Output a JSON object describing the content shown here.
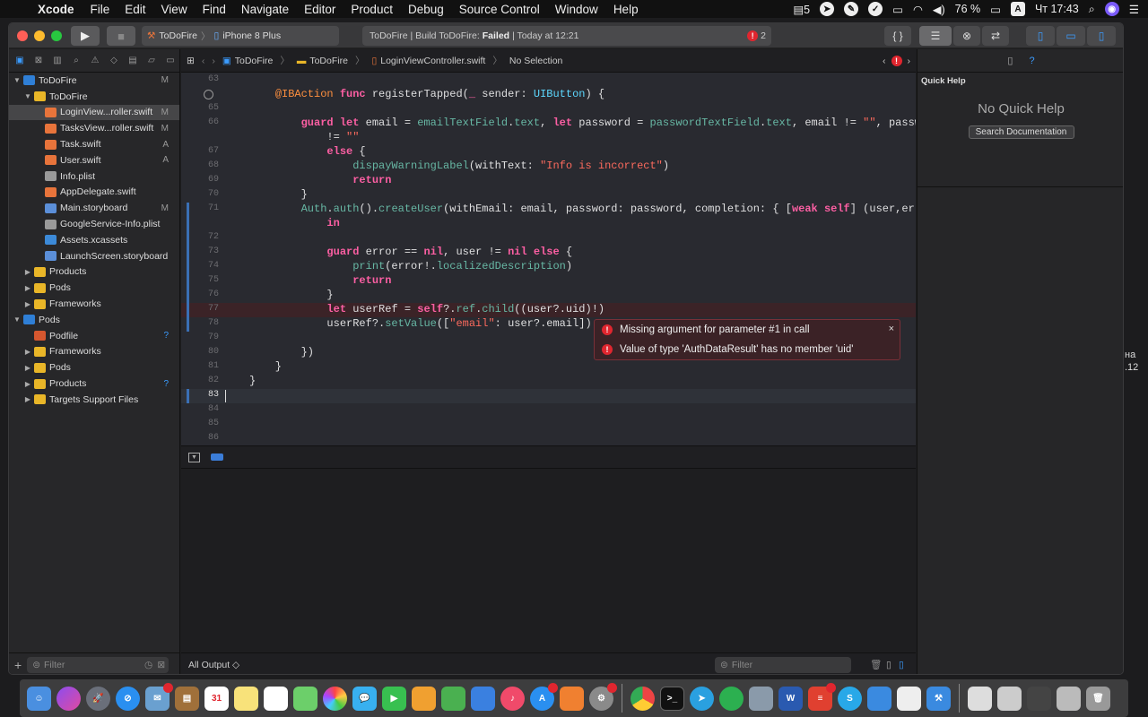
{
  "menubar": {
    "app": "Xcode",
    "menus": [
      "File",
      "Edit",
      "View",
      "Find",
      "Navigate",
      "Editor",
      "Product",
      "Debug",
      "Source Control",
      "Window",
      "Help"
    ],
    "right": {
      "badge_count": "5",
      "battery": "76 %",
      "input_lang": "A",
      "clock": "Чт 17:43"
    }
  },
  "toolbar": {
    "scheme_project": "ToDoFire",
    "scheme_device": "iPhone 8 Plus",
    "status_prefix": "ToDoFire | Build ToDoFire:",
    "status_result": "Failed",
    "status_time": "| Today at 12:21",
    "error_count": "2",
    "braces": "{ }"
  },
  "navigator": {
    "items": [
      {
        "label": "ToDoFire",
        "status": "M",
        "indent": 0,
        "icon": "proj",
        "disc": "▼"
      },
      {
        "label": "ToDoFire",
        "status": "",
        "indent": 1,
        "icon": "folder",
        "disc": "▼"
      },
      {
        "label": "LoginView...roller.swift",
        "status": "M",
        "indent": 2,
        "icon": "swift",
        "disc": "",
        "selected": true
      },
      {
        "label": "TasksView...roller.swift",
        "status": "M",
        "indent": 2,
        "icon": "swift",
        "disc": ""
      },
      {
        "label": "Task.swift",
        "status": "A",
        "indent": 2,
        "icon": "swift",
        "disc": ""
      },
      {
        "label": "User.swift",
        "status": "A",
        "indent": 2,
        "icon": "swift",
        "disc": ""
      },
      {
        "label": "Info.plist",
        "status": "",
        "indent": 2,
        "icon": "plist",
        "disc": ""
      },
      {
        "label": "AppDelegate.swift",
        "status": "",
        "indent": 2,
        "icon": "swift",
        "disc": ""
      },
      {
        "label": "Main.storyboard",
        "status": "M",
        "indent": 2,
        "icon": "sb",
        "disc": ""
      },
      {
        "label": "GoogleService-Info.plist",
        "status": "",
        "indent": 2,
        "icon": "plist",
        "disc": ""
      },
      {
        "label": "Assets.xcassets",
        "status": "",
        "indent": 2,
        "icon": "assets",
        "disc": ""
      },
      {
        "label": "LaunchScreen.storyboard",
        "status": "",
        "indent": 2,
        "icon": "sb",
        "disc": ""
      },
      {
        "label": "Products",
        "status": "",
        "indent": 1,
        "icon": "folder",
        "disc": "▶"
      },
      {
        "label": "Pods",
        "status": "",
        "indent": 1,
        "icon": "folder",
        "disc": "▶"
      },
      {
        "label": "Frameworks",
        "status": "",
        "indent": 1,
        "icon": "folder",
        "disc": "▶"
      },
      {
        "label": "Pods",
        "status": "",
        "indent": 0,
        "icon": "proj",
        "disc": "▼"
      },
      {
        "label": "Podfile",
        "status": "?",
        "indent": 1,
        "icon": "pod",
        "disc": ""
      },
      {
        "label": "Frameworks",
        "status": "",
        "indent": 1,
        "icon": "folder",
        "disc": "▶"
      },
      {
        "label": "Pods",
        "status": "",
        "indent": 1,
        "icon": "folder",
        "disc": "▶"
      },
      {
        "label": "Products",
        "status": "?",
        "indent": 1,
        "icon": "folder",
        "disc": "▶"
      },
      {
        "label": "Targets Support Files",
        "status": "",
        "indent": 1,
        "icon": "folder",
        "disc": "▶"
      }
    ],
    "filter_placeholder": "Filter"
  },
  "jumpbar": {
    "crumbs": [
      "ToDoFire",
      "ToDoFire",
      "LoginViewController.swift",
      "No Selection"
    ]
  },
  "code": {
    "lines": [
      {
        "n": "63",
        "html": ""
      },
      {
        "n": "",
        "html": "    <span class='at'>@IBAction</span> <span class='kw'>func</span> registerTapped(<span class='kw'>_</span> sender: <span class='ty'>UIButton</span>) {",
        "bp": true
      },
      {
        "n": "65",
        "html": ""
      },
      {
        "n": "66",
        "html": "        <span class='kw'>guard let</span> email = <span class='fn'>emailTextField</span>.<span class='fn'>text</span>, <span class='kw'>let</span> password = <span class='fn'>passwordTextField</span>.<span class='fn'>text</span>, email != <span class='st2'>\"\"</span>, password"
      },
      {
        "n": "",
        "html": "            != <span class='st2'>\"\"</span>"
      },
      {
        "n": "67",
        "html": "            <span class='kw'>else</span> {"
      },
      {
        "n": "68",
        "html": "                <span class='fn'>dispayWarningLabel</span>(withText: <span class='st2'>\"Info is incorrect\"</span>)"
      },
      {
        "n": "69",
        "html": "                <span class='kw'>return</span>"
      },
      {
        "n": "70",
        "html": "        }"
      },
      {
        "n": "71",
        "html": "        <span class='fn'>Auth</span>.<span class='fn'>auth</span>().<span class='fn'>createUser</span>(withEmail: email, password: password, completion: { [<span class='kw'>weak</span> <span class='kw'>self</span>] (user,error)",
        "chg": true
      },
      {
        "n": "",
        "html": "            <span class='kw'>in</span>",
        "chg": true
      },
      {
        "n": "72",
        "html": "",
        "chg": true
      },
      {
        "n": "73",
        "html": "            <span class='kw'>guard</span> error == <span class='kw'>nil</span>, user != <span class='kw'>nil</span> <span class='kw'>else</span> {",
        "chg": true
      },
      {
        "n": "74",
        "html": "                <span class='fn'>print</span>(error!.<span class='fn'>localizedDescription</span>)",
        "chg": true
      },
      {
        "n": "75",
        "html": "                <span class='kw'>return</span>",
        "chg": true
      },
      {
        "n": "76",
        "html": "            }",
        "chg": true
      },
      {
        "n": "77",
        "html": "            <span class='kw'>let</span> userRef = <span class='kw'>self</span>?.<span class='fn'>ref</span>.<span class='fn'>child</span>((user?.uid)!)",
        "err": true,
        "chg": true
      },
      {
        "n": "78",
        "html": "            userRef?.<span class='fn'>setValue</span>([<span class='st2'>\"email\"</span>: user?.email])",
        "chg": true
      },
      {
        "n": "79",
        "html": ""
      },
      {
        "n": "80",
        "html": "        })"
      },
      {
        "n": "81",
        "html": "    }"
      },
      {
        "n": "82",
        "html": "}"
      },
      {
        "n": "83",
        "html": "",
        "cur": true
      },
      {
        "n": "84",
        "html": ""
      },
      {
        "n": "85",
        "html": ""
      },
      {
        "n": "86",
        "html": ""
      }
    ]
  },
  "errors": {
    "items": [
      "Missing argument for parameter #1 in call",
      "Value of type 'AuthDataResult' has no member 'uid'"
    ],
    "close": "×"
  },
  "console": {
    "output_label": "All Output ◇",
    "filter_placeholder": "Filter"
  },
  "inspector": {
    "title": "Quick Help",
    "empty": "No Quick Help",
    "search_button": "Search Documentation"
  },
  "desktop": {
    "text1": "на",
    "text2": ".12"
  },
  "colors": {
    "accent": "#3b9cff",
    "error": "#e0262f",
    "keyword": "#fc5fa3",
    "string": "#fc6a5d",
    "type": "#5dd8ff"
  }
}
